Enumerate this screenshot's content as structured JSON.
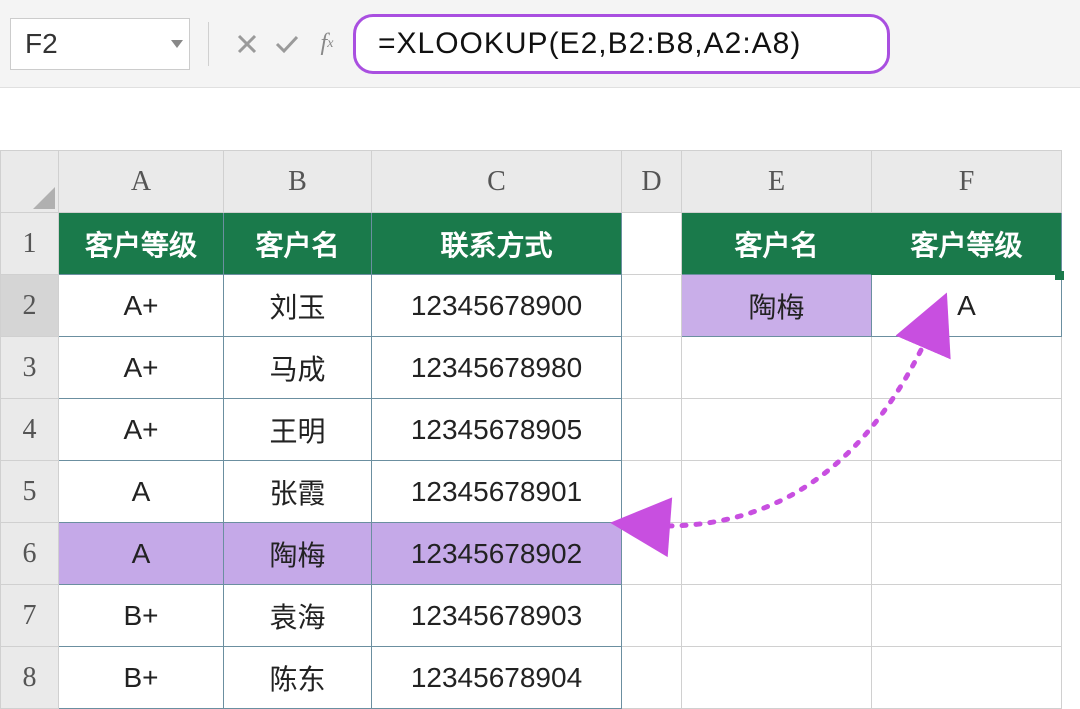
{
  "toolbar": {
    "nameBox": "F2",
    "formula": "=XLOOKUP(E2,B2:B8,A2:A8)"
  },
  "columns": [
    "A",
    "B",
    "C",
    "D",
    "E",
    "F"
  ],
  "rowNumbers": [
    "1",
    "2",
    "3",
    "4",
    "5",
    "6",
    "7",
    "8"
  ],
  "headers": {
    "A": "客户等级",
    "B": "客户名",
    "C": "联系方式",
    "E": "客户名",
    "F": "客户等级"
  },
  "table": [
    {
      "a": "A+",
      "b": "刘玉",
      "c": "12345678900"
    },
    {
      "a": "A+",
      "b": "马成",
      "c": "12345678980"
    },
    {
      "a": "A+",
      "b": "王明",
      "c": "12345678905"
    },
    {
      "a": "A",
      "b": "张霞",
      "c": "12345678901"
    },
    {
      "a": "A",
      "b": "陶梅",
      "c": "12345678902"
    },
    {
      "a": "B+",
      "b": "袁海",
      "c": "12345678903"
    },
    {
      "a": "B+",
      "b": "陈东",
      "c": "12345678904"
    }
  ],
  "lookup": {
    "e2": "陶梅",
    "f2": "A"
  },
  "colors": {
    "headerGreen": "#1a7a4b",
    "highlightPurple": "#c5a9e8",
    "formulaBorder": "#a94fe0"
  }
}
